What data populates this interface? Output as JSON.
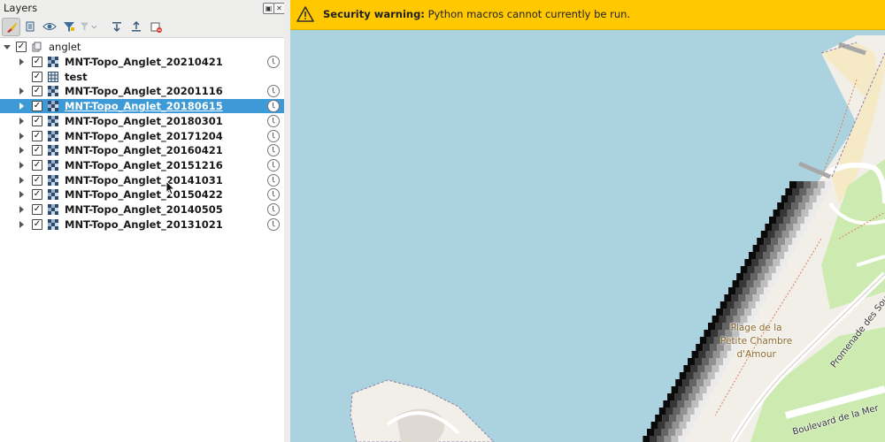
{
  "layers_panel": {
    "title": "Layers",
    "title_buttons": [
      "float-icon",
      "close-icon"
    ],
    "toolbar": [
      "style-brush-icon",
      "add-group-icon",
      "visibility-eye-icon",
      "filter-icon",
      "filter-legend-icon",
      "expand-all-icon",
      "collapse-all-icon",
      "remove-layer-icon"
    ],
    "group": {
      "name": "anglet",
      "checked": true,
      "expanded": true
    },
    "layers": [
      {
        "name": "MNT-Topo_Anglet_20210421",
        "checked": true,
        "type": "raster",
        "selected": false,
        "temporal": true
      },
      {
        "name": "test",
        "checked": true,
        "type": "mesh",
        "selected": false,
        "temporal": false
      },
      {
        "name": "MNT-Topo_Anglet_20201116",
        "checked": true,
        "type": "raster",
        "selected": false,
        "temporal": true
      },
      {
        "name": "MNT-Topo_Anglet_20180615",
        "checked": true,
        "type": "raster",
        "selected": true,
        "temporal": true
      },
      {
        "name": "MNT-Topo_Anglet_20180301",
        "checked": true,
        "type": "raster",
        "selected": false,
        "temporal": true
      },
      {
        "name": "MNT-Topo_Anglet_20171204",
        "checked": true,
        "type": "raster",
        "selected": false,
        "temporal": true
      },
      {
        "name": "MNT-Topo_Anglet_20160421",
        "checked": true,
        "type": "raster",
        "selected": false,
        "temporal": true
      },
      {
        "name": "MNT-Topo_Anglet_20151216",
        "checked": true,
        "type": "raster",
        "selected": false,
        "temporal": true
      },
      {
        "name": "MNT-Topo_Anglet_20141031",
        "checked": true,
        "type": "raster",
        "selected": false,
        "temporal": true
      },
      {
        "name": "MNT-Topo_Anglet_20150422",
        "checked": true,
        "type": "raster",
        "selected": false,
        "temporal": true
      },
      {
        "name": "MNT-Topo_Anglet_20140505",
        "checked": true,
        "type": "raster",
        "selected": false,
        "temporal": true
      },
      {
        "name": "MNT-Topo_Anglet_20131021",
        "checked": true,
        "type": "raster",
        "selected": false,
        "temporal": true
      }
    ]
  },
  "banner": {
    "title": "Security warning:",
    "message": "Python macros cannot currently be run.",
    "icon": "warning-icon"
  },
  "map": {
    "place_label_lines": [
      "Plage de la",
      "Petite Chambre",
      "d'Amour"
    ],
    "street_promenade": "Promenade des Sources",
    "street_boulevard": "Boulevard de la Mer"
  },
  "colors": {
    "sea": "#aad3df",
    "banner": "#ffc800",
    "selection": "#3d9ad6",
    "sand": "#f5e9c6",
    "land": "#f2efe9"
  }
}
